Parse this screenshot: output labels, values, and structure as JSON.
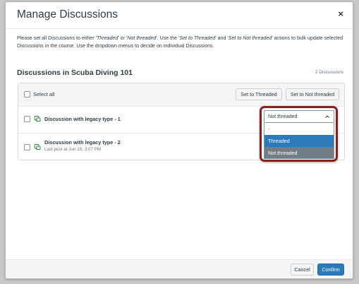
{
  "modal": {
    "title": "Manage Discussions",
    "close_glyph": "×"
  },
  "instructions": {
    "p1": "Please set all Discussions to either '",
    "threaded": "Threaded",
    "p2": "' or '",
    "not_threaded": "Not threaded",
    "p3": "'. Use the '",
    "set_threaded": "Set to Threaded",
    "p4": "' and '",
    "set_not_threaded": "Set to Not threaded",
    "p5": "' actions to bulk update selected Discussions in the course. Use the dropdown menus to decide on individual Discussions."
  },
  "section": {
    "title": "Discussions in Scuba Diving 101",
    "count": "2 Discussions"
  },
  "table_header": {
    "select_all": "Select all",
    "set_threaded_button": "Set to Threaded",
    "set_not_threaded_button": "Set to Not threaded"
  },
  "discussions": [
    {
      "title": "Discussion with legacy type - 1",
      "subtitle": ""
    },
    {
      "title": "Discussion with legacy type - 2",
      "subtitle": "Last post at Jun 16, 3:07 PM"
    }
  ],
  "dropdown": {
    "selected": "Not threaded",
    "options": [
      "-",
      "Threaded",
      "Not threaded"
    ],
    "highlighted_option": "Threaded"
  },
  "footer": {
    "cancel": "Cancel",
    "confirm": "Confirm"
  },
  "colors": {
    "primary": "#2b7abc",
    "highlight_border": "#8c1d1d",
    "discussion_icon": "#2e8b3d"
  },
  "icons": {
    "close": "close-icon",
    "discussion": "discussion-icon",
    "chevron": "chevron-up-icon"
  }
}
